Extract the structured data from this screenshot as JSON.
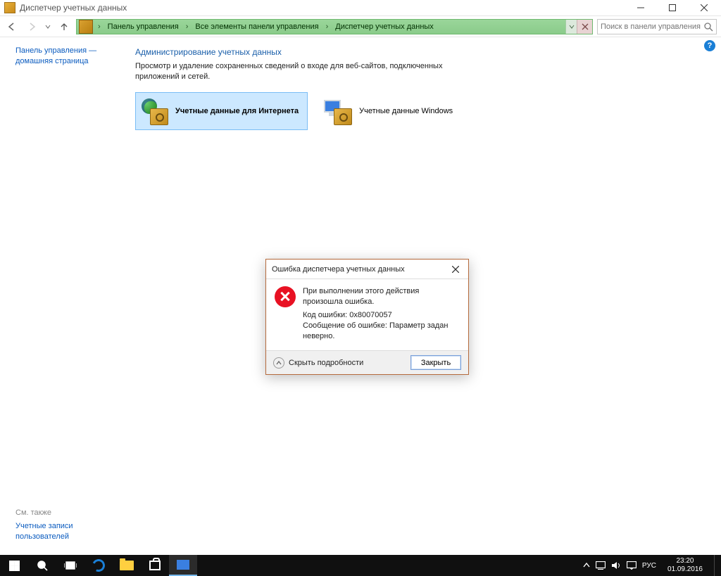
{
  "window": {
    "title": "Диспетчер учетных данных"
  },
  "breadcrumb": {
    "items": [
      "Панель управления",
      "Все элементы панели управления",
      "Диспетчер учетных данных"
    ]
  },
  "search": {
    "placeholder": "Поиск в панели управления"
  },
  "sidebar": {
    "home_link": "Панель управления — домашняя страница",
    "see_also": "См. также",
    "bottom_link": "Учетные записи пользователей"
  },
  "main": {
    "heading": "Администрирование учетных данных",
    "description": "Просмотр и удаление сохраненных сведений о входе для веб-сайтов, подключенных приложений и сетей.",
    "tiles": {
      "web": "Учетные данные для Интернета",
      "windows": "Учетные данные Windows"
    }
  },
  "dialog": {
    "title": "Ошибка диспетчера учетных данных",
    "message": "При выполнении этого действия произошла ошибка.",
    "code_line": "Код ошибки: 0x80070057",
    "detail_line": "Сообщение об ошибке: Параметр задан неверно.",
    "toggle": "Скрыть подробности",
    "close": "Закрыть"
  },
  "taskbar": {
    "lang": "РУС",
    "time": "23:20",
    "date": "01.09.2016"
  }
}
